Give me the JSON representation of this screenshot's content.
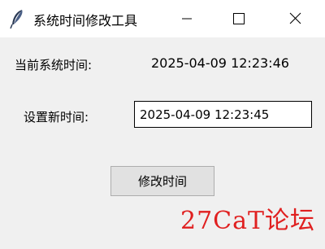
{
  "window": {
    "title": "系统时间修改工具",
    "icon": "feather-icon",
    "controls": {
      "minimize": "minimize-icon",
      "maximize": "maximize-icon",
      "close": "close-icon"
    }
  },
  "current_time": {
    "label": "当前系统时间:",
    "value": "2025-04-09 12:23:46"
  },
  "new_time": {
    "label": "设置新时间:",
    "value": "2025-04-09 12:23:45"
  },
  "modify_button": {
    "label": "修改时间"
  },
  "watermark": {
    "text": "27CaT论坛",
    "color": "#e02020"
  }
}
